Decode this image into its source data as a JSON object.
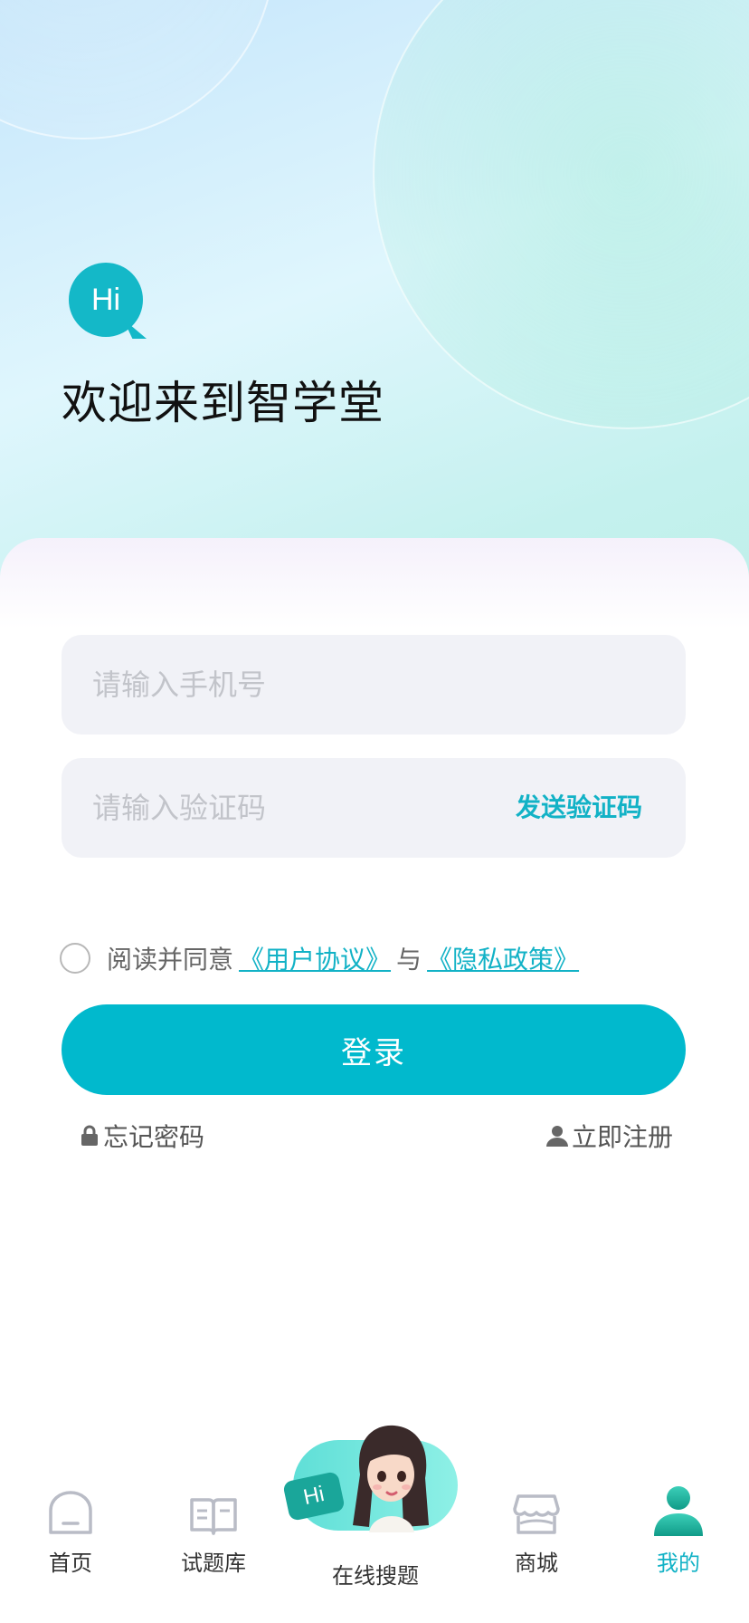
{
  "hero": {
    "badge_text": "Hi",
    "welcome_title": "欢迎来到智学堂"
  },
  "form": {
    "phone_placeholder": "请输入手机号",
    "code_placeholder": "请输入验证码",
    "send_code_label": "发送验证码",
    "agree_prefix": "阅读并同意",
    "user_agreement_link": "《用户协议》",
    "agree_conjunction": "与",
    "privacy_policy_link": "《隐私政策》",
    "login_label": "登录",
    "forgot_password_label": "忘记密码",
    "register_label": "立即注册",
    "agreement_checked": false
  },
  "tabbar": {
    "items": [
      {
        "label": "首页",
        "icon": "home-icon",
        "active": false
      },
      {
        "label": "试题库",
        "icon": "book-icon",
        "active": false
      },
      {
        "label": "在线搜题",
        "icon": "mascot-hi-icon",
        "badge": "Hi",
        "active": false
      },
      {
        "label": "商城",
        "icon": "store-icon",
        "active": false
      },
      {
        "label": "我的",
        "icon": "user-icon",
        "active": true
      }
    ]
  },
  "colors": {
    "accent": "#01b9cd",
    "link": "#12b2c6",
    "input_bg": "#f1f2f7"
  }
}
